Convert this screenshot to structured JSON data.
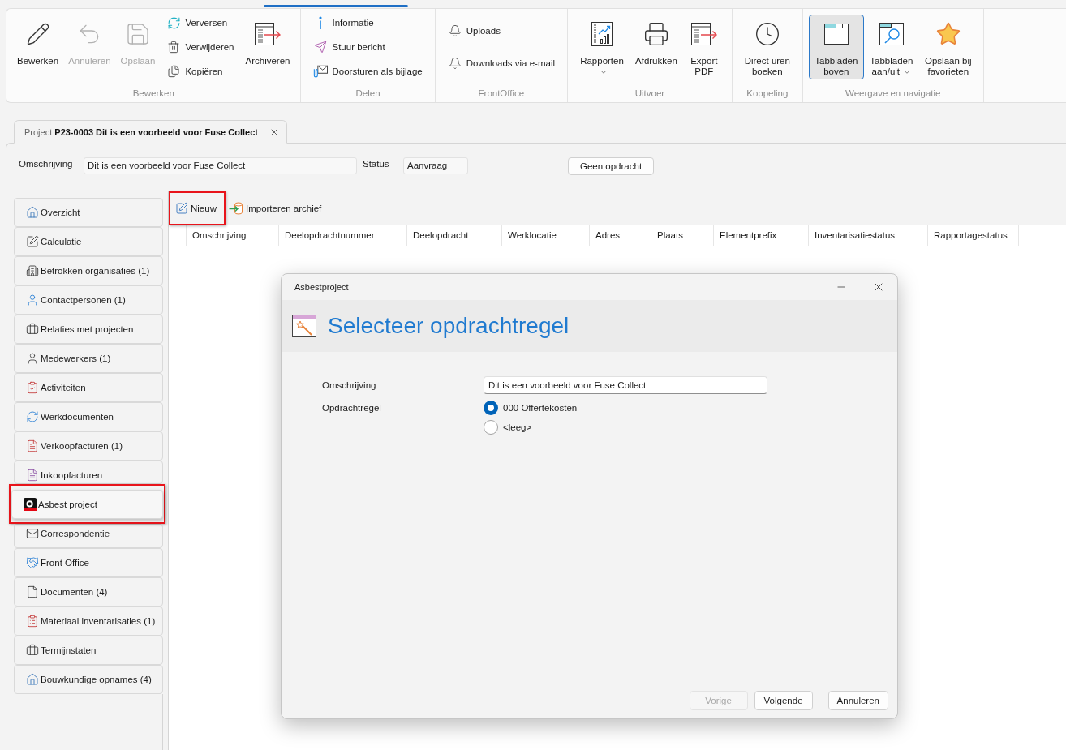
{
  "ribbon": {
    "groups": [
      {
        "label": "Bewerken",
        "items": [
          {
            "kind": "large",
            "label": "Bewerken",
            "disabled": false,
            "pressed": false,
            "dropdown": false
          },
          {
            "kind": "large",
            "label": "Annuleren",
            "disabled": true,
            "pressed": false,
            "dropdown": false
          },
          {
            "kind": "large",
            "label": "Opslaan",
            "disabled": true,
            "pressed": false,
            "dropdown": false
          },
          {
            "kind": "small",
            "label": "Verversen",
            "disabled": false,
            "pressed": false,
            "dropdown": false
          },
          {
            "kind": "small",
            "label": "Verwijderen",
            "disabled": false,
            "pressed": false,
            "dropdown": false
          },
          {
            "kind": "small",
            "label": "Kopiëren",
            "disabled": false,
            "pressed": false,
            "dropdown": false
          },
          {
            "kind": "large",
            "label": "Archiveren",
            "disabled": false,
            "pressed": false,
            "dropdown": false
          }
        ]
      },
      {
        "label": "Delen",
        "items": [
          {
            "kind": "small",
            "label": "Informatie",
            "disabled": false,
            "pressed": false,
            "dropdown": false
          },
          {
            "kind": "small",
            "label": "Stuur bericht",
            "disabled": false,
            "pressed": false,
            "dropdown": false
          },
          {
            "kind": "small",
            "label": "Doorsturen als bijlage",
            "disabled": false,
            "pressed": false,
            "dropdown": false
          }
        ]
      },
      {
        "label": "FrontOffice",
        "items": [
          {
            "kind": "small",
            "label": "Uploads",
            "disabled": false,
            "pressed": false,
            "dropdown": false
          },
          {
            "kind": "small",
            "label": "Downloads via e-mail",
            "disabled": false,
            "pressed": false,
            "dropdown": false
          }
        ]
      },
      {
        "label": "Uitvoer",
        "items": [
          {
            "kind": "large",
            "label": "Rapporten",
            "disabled": false,
            "pressed": false,
            "dropdown": true
          },
          {
            "kind": "large",
            "label": "Afdrukken",
            "disabled": false,
            "pressed": false,
            "dropdown": false
          },
          {
            "kind": "large",
            "label": "Export PDF",
            "disabled": false,
            "pressed": false,
            "dropdown": false
          }
        ]
      },
      {
        "label": "Koppeling",
        "items": [
          {
            "kind": "large",
            "label": "Direct uren boeken",
            "disabled": false,
            "pressed": false,
            "dropdown": false
          }
        ]
      },
      {
        "label": "Weergave en navigatie",
        "items": [
          {
            "kind": "large",
            "label": "Tabbladen boven",
            "disabled": false,
            "pressed": true,
            "dropdown": false
          },
          {
            "kind": "large",
            "label": "Tabbladen aan/uit",
            "disabled": false,
            "pressed": false,
            "dropdown": true
          },
          {
            "kind": "large",
            "label": "Opslaan bij favorieten",
            "disabled": false,
            "pressed": false,
            "dropdown": false
          }
        ]
      }
    ]
  },
  "document_tab": {
    "label": "Project **P23-0003 Dit is een voorbeeld voor Fuse Collect**"
  },
  "project_header": {
    "fields": [
      {
        "label": "Omschrijving",
        "value": "Dit is een voorbeeld voor Fuse Collect"
      },
      {
        "label": "Status",
        "value": "Aanvraag"
      }
    ],
    "action_button": "Geen opdracht"
  },
  "sidebar": {
    "items": [
      {
        "label": "Overzicht",
        "selected": false,
        "highlighted": false
      },
      {
        "label": "Calculatie",
        "selected": false,
        "highlighted": false
      },
      {
        "label": "Betrokken organisaties (1)",
        "selected": false,
        "highlighted": false
      },
      {
        "label": "Contactpersonen (1)",
        "selected": false,
        "highlighted": false
      },
      {
        "label": "Relaties met projecten",
        "selected": false,
        "highlighted": false
      },
      {
        "label": "Medewerkers (1)",
        "selected": false,
        "highlighted": false
      },
      {
        "label": "Activiteiten",
        "selected": false,
        "highlighted": false
      },
      {
        "label": "Werkdocumenten",
        "selected": false,
        "highlighted": false
      },
      {
        "label": "Verkoopfacturen (1)",
        "selected": false,
        "highlighted": false
      },
      {
        "label": "Inkoopfacturen",
        "selected": false,
        "highlighted": false
      },
      {
        "label": "Asbest project",
        "selected": true,
        "highlighted": true
      },
      {
        "label": "Correspondentie",
        "selected": false,
        "highlighted": false
      },
      {
        "label": "Front Office",
        "selected": false,
        "highlighted": false
      },
      {
        "label": "Documenten (4)",
        "selected": false,
        "highlighted": false
      },
      {
        "label": "Materiaal inventarisaties (1)",
        "selected": false,
        "highlighted": false
      },
      {
        "label": "Termijnstaten",
        "selected": false,
        "highlighted": false
      },
      {
        "label": "Bouwkundige opnames (4)",
        "selected": false,
        "highlighted": false
      }
    ]
  },
  "toolbar": {
    "buttons": [
      {
        "label": "Nieuw",
        "highlighted": true
      },
      {
        "label": "Importeren archief",
        "highlighted": false
      }
    ]
  },
  "table": {
    "columns": [
      "Omschrijving",
      "Deelopdrachtnummer",
      "Deelopdracht",
      "Werklocatie",
      "Adres",
      "Plaats",
      "Elementprefix",
      "Inventarisatiestatus",
      "Rapportagestatus"
    ]
  },
  "dialog": {
    "title": "Asbestproject",
    "heading": "Selecteer opdrachtregel",
    "fields": [
      {
        "label": "Omschrijving",
        "value": "Dit is een voorbeeld voor Fuse Collect"
      }
    ],
    "choice": {
      "label": "Opdrachtregel",
      "options": [
        {
          "label": "000 Offertekosten",
          "selected": true
        },
        {
          "label": "<leeg>",
          "selected": false
        }
      ]
    },
    "buttons": [
      {
        "label": "Vorige",
        "disabled": true
      },
      {
        "label": "Volgende",
        "disabled": false
      },
      {
        "label": "Annuleren",
        "disabled": false
      }
    ]
  }
}
